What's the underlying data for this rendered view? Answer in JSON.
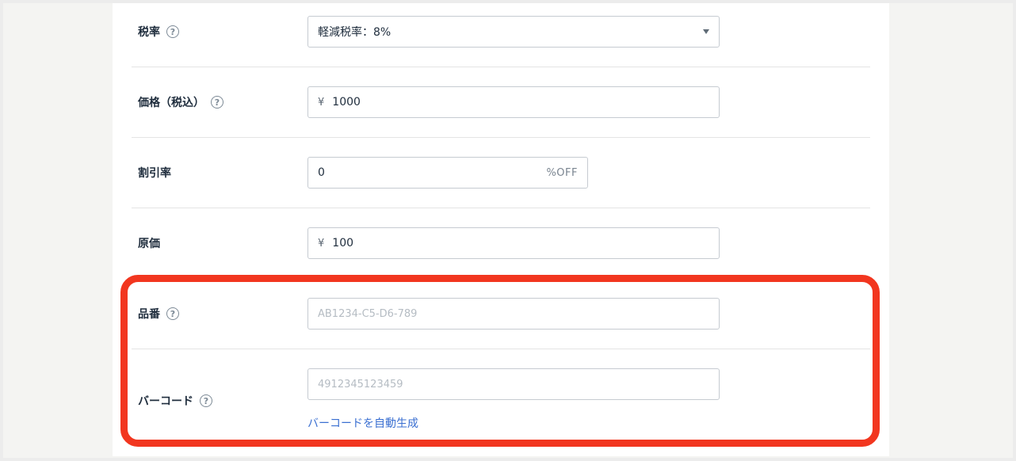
{
  "tax_rate": {
    "label": "税率",
    "help_glyph": "?",
    "selected": "軽減税率：8%"
  },
  "price": {
    "label": "価格（税込）",
    "help_glyph": "?",
    "currency": "¥",
    "value": "1000"
  },
  "discount": {
    "label": "割引率",
    "value": "0",
    "suffix": "%OFF"
  },
  "cost": {
    "label": "原価",
    "currency": "¥",
    "value": "100"
  },
  "sku": {
    "label": "品番",
    "help_glyph": "?",
    "placeholder": "AB1234-C5-D6-789"
  },
  "barcode": {
    "label": "バーコード",
    "help_glyph": "?",
    "placeholder": "4912345123459",
    "auto_generate_link": "バーコードを自動生成"
  },
  "colors": {
    "highlight": "#f2361f",
    "link": "#3a6fd1"
  }
}
